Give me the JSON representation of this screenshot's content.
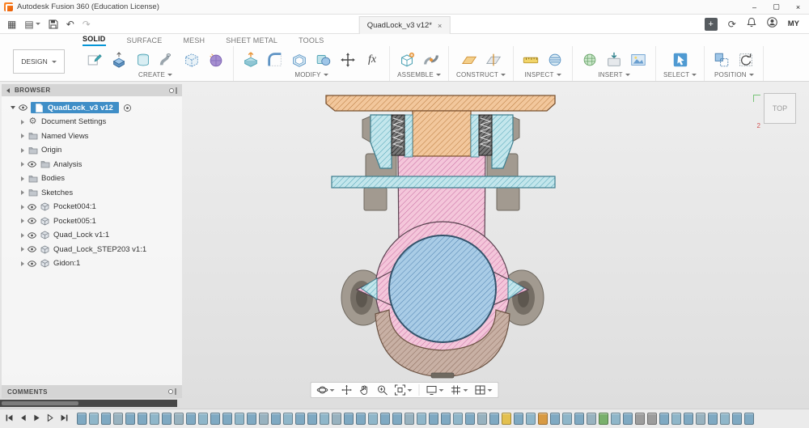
{
  "window": {
    "title": "Autodesk Fusion 360 (Education License)"
  },
  "icons": {
    "app_grid": "▦",
    "file_menu": "▤",
    "undo": "↶",
    "redo": "↷",
    "minimize": "–",
    "maximize": "▢",
    "close": "×",
    "tab_close": "×",
    "new_tab": "+",
    "sync": "⟳",
    "gear": "⚙"
  },
  "appbar": {
    "tab_title": "QuadLock_v3 v12*",
    "profile_label": "MY"
  },
  "ribbon": {
    "workspace_label": "DESIGN",
    "active_tab": "SOLID",
    "tabs": [
      {
        "label": "SOLID"
      },
      {
        "label": "SURFACE"
      },
      {
        "label": "MESH"
      },
      {
        "label": "SHEET METAL"
      },
      {
        "label": "TOOLS"
      }
    ],
    "groups": [
      {
        "label": "CREATE"
      },
      {
        "label": "MODIFY"
      },
      {
        "label": "ASSEMBLE"
      },
      {
        "label": "CONSTRUCT"
      },
      {
        "label": "INSPECT"
      },
      {
        "label": "INSERT"
      },
      {
        "label": "SELECT"
      },
      {
        "label": "POSITION"
      }
    ],
    "fx_label": "fx"
  },
  "browser": {
    "header": "BROWSER",
    "root_label": "QuadLock_v3 v12",
    "items": [
      {
        "label": "Document Settings",
        "icon": "gear",
        "eye": false
      },
      {
        "label": "Named Views",
        "icon": "folder",
        "eye": false
      },
      {
        "label": "Origin",
        "icon": "folder",
        "eye": false
      },
      {
        "label": "Analysis",
        "icon": "folder",
        "eye": true
      },
      {
        "label": "Bodies",
        "icon": "folder",
        "eye": false
      },
      {
        "label": "Sketches",
        "icon": "folder",
        "eye": false
      },
      {
        "label": "Pocket004:1",
        "icon": "component",
        "eye": true
      },
      {
        "label": "Pocket005:1",
        "icon": "component",
        "eye": true
      },
      {
        "label": "Quad_Lock v1:1",
        "icon": "component",
        "eye": true
      },
      {
        "label": "Quad_Lock_STEP203 v1:1",
        "icon": "component",
        "eye": true
      },
      {
        "label": "Gidon:1",
        "icon": "component",
        "eye": true
      }
    ]
  },
  "comments": {
    "header": "COMMENTS"
  },
  "viewcube": {
    "top_label": "TOP",
    "axis_label": "2"
  },
  "colors": {
    "accent": "#0696d7",
    "selection": "#3f8ec7",
    "hatch_orange": "#f2c79c",
    "hatch_pink": "#f4c6da",
    "hatch_ball_blue": "#a9cce6",
    "hatch_cyan": "#c3e6ec",
    "hatch_brown": "#c8b0a4"
  },
  "timeline": {
    "icon_colors": [
      "#7fa9c2",
      "#8fb6c9",
      "#7fa9c2",
      "#98b2bf",
      "#7fa9c2",
      "#7fa9c2",
      "#8fb6c9",
      "#7fa9c2",
      "#98b2bf",
      "#7fa9c2",
      "#8fb6c9",
      "#7fa9c2",
      "#7fa9c2",
      "#8fb6c9",
      "#7fa9c2",
      "#98b2bf",
      "#7fa9c2",
      "#8fb6c9",
      "#7fa9c2",
      "#7fa9c2",
      "#8fb6c9",
      "#98b2bf",
      "#7fa9c2",
      "#7fa9c2",
      "#8fb6c9",
      "#7fa9c2",
      "#7fa9c2",
      "#98b2bf",
      "#8fb6c9",
      "#7fa9c2",
      "#7fa9c2",
      "#8fb6c9",
      "#7fa9c2",
      "#98b2bf",
      "#7fa9c2",
      "#e3c04f",
      "#7fa9c2",
      "#8fb6c9",
      "#d89a43",
      "#7fa9c2",
      "#8fb6c9",
      "#7fa9c2",
      "#98b2bf",
      "#79b06c",
      "#8fb6c9",
      "#7fa9c2",
      "#9c9c9c",
      "#9c9c9c",
      "#7fa9c2",
      "#8fb6c9",
      "#7fa9c2",
      "#98b2bf",
      "#7fa9c2",
      "#8fb6c9",
      "#7fa9c2",
      "#7fa9c2"
    ]
  }
}
